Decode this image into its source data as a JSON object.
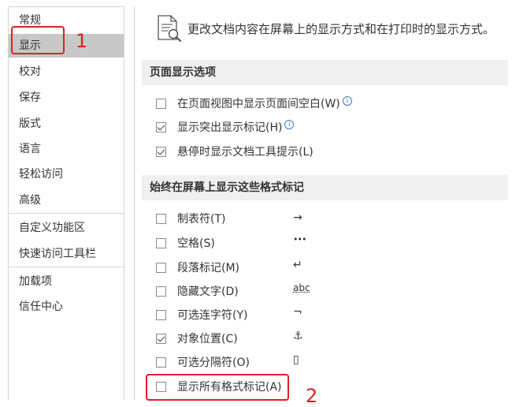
{
  "sidebar": {
    "items": [
      {
        "label": "常规"
      },
      {
        "label": "显示"
      },
      {
        "label": "校对"
      },
      {
        "label": "保存"
      },
      {
        "label": "版式"
      },
      {
        "label": "语言"
      },
      {
        "label": "轻松访问"
      },
      {
        "label": "高级"
      },
      {
        "label": "自定义功能区"
      },
      {
        "label": "快速访问工具栏"
      },
      {
        "label": "加载项"
      },
      {
        "label": "信任中心"
      }
    ],
    "selected": "显示"
  },
  "annotations": {
    "label_1": "1",
    "label_2": "2",
    "color": "#e02020"
  },
  "main": {
    "header_text": "更改文档内容在屏幕上的显示方式和在打印时的显示方式。",
    "page_display": {
      "title": "页面显示选项",
      "options": [
        {
          "label": "在页面视图中显示页面间空白(W)",
          "checked": false,
          "info": true
        },
        {
          "label": "显示突出显示标记(H)",
          "checked": true,
          "info": true
        },
        {
          "label": "悬停时显示文档工具提示(L)",
          "checked": true,
          "info": false
        }
      ]
    },
    "format_marks": {
      "title": "始终在屏幕上显示这些格式标记",
      "options": [
        {
          "label": "制表符(T)",
          "checked": false,
          "symbol": "→"
        },
        {
          "label": "空格(S)",
          "checked": false,
          "symbol": "•••"
        },
        {
          "label": "段落标记(M)",
          "checked": false,
          "symbol": "↵"
        },
        {
          "label": "隐藏文字(D)",
          "checked": false,
          "symbol": "abc"
        },
        {
          "label": "可选连字符(Y)",
          "checked": false,
          "symbol": "¬"
        },
        {
          "label": "对象位置(C)",
          "checked": true,
          "symbol": "⚓"
        },
        {
          "label": "可选分隔符(O)",
          "checked": false,
          "symbol": "▯"
        },
        {
          "label": "显示所有格式标记(A)",
          "checked": false,
          "symbol": ""
        }
      ]
    }
  }
}
